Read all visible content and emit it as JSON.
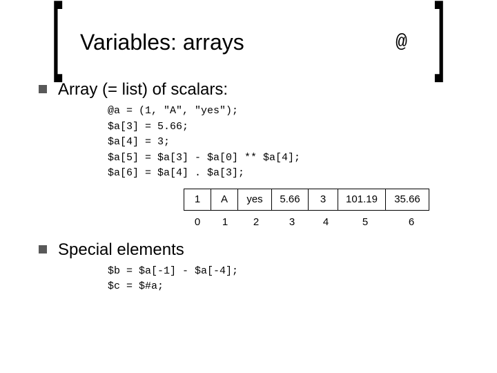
{
  "title": "Variables: arrays",
  "at_glyph": "@",
  "bullet1": "Array (= list) of scalars:",
  "code1": {
    "l1": "@a = (1, \"A\", \"yes\");",
    "l2": "$a[3] = 5.66;",
    "l3": "$a[4] = 3;",
    "l4": "$a[5] = $a[3] - $a[0] ** $a[4];",
    "l5": "$a[6] = $a[4] . $a[3];"
  },
  "array": {
    "cells": [
      "1",
      "A",
      "yes",
      "5.66",
      "3",
      "101.19",
      "35.66"
    ],
    "indices": [
      "0",
      "1",
      "2",
      "3",
      "4",
      "5",
      "6"
    ]
  },
  "bullet2": "Special elements",
  "code2": {
    "l1": "$b = $a[-1] - $a[-4];",
    "l2": "$c = $#a;"
  }
}
